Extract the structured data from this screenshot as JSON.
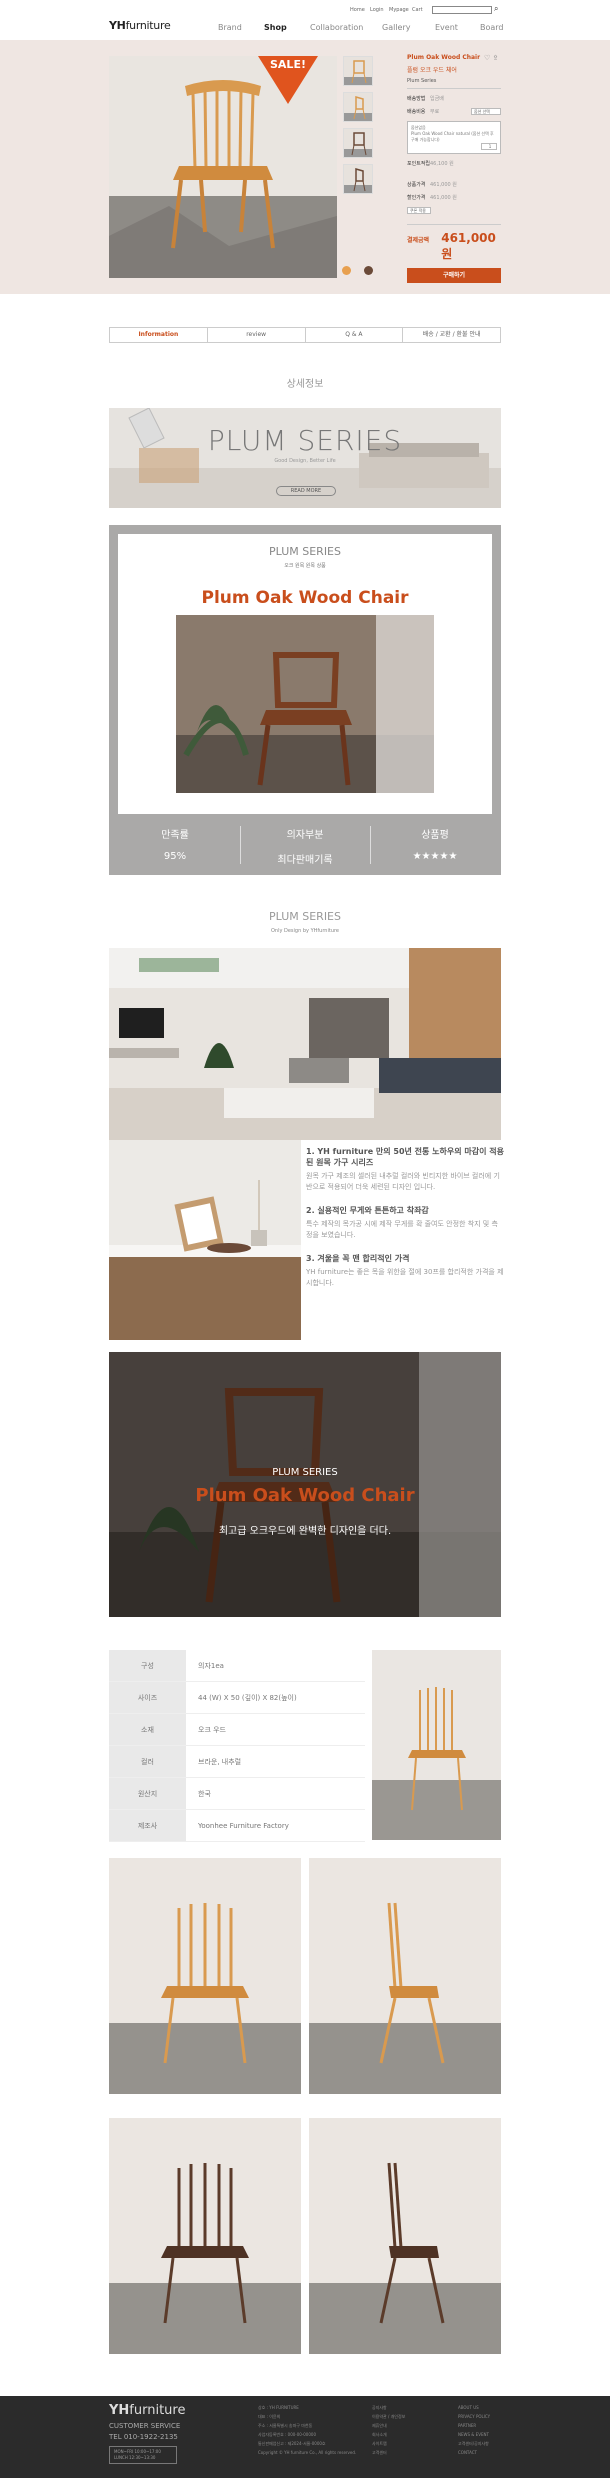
{
  "header": {
    "logo_bold": "YH",
    "logo_light": "furniture",
    "util_links": [
      "Home",
      "Login",
      "Mypage",
      "Cart"
    ],
    "nav": [
      "Brand",
      "Shop",
      "Collaboration",
      "Gallery",
      "Event",
      "Board"
    ],
    "active_nav": "Shop"
  },
  "product": {
    "sale_label": "SALE!",
    "name": "Plum Oak Wood Chair",
    "subtitle": "플럼 오크 우드 체어",
    "series": "Plum Series",
    "rows": [
      {
        "key": "배송방법",
        "value": "입금배"
      },
      {
        "key": "배송비용",
        "value": "무료"
      }
    ],
    "option_placeholder": "옵션 선택",
    "option_box_title": "옵션없음",
    "option_box_text": "Plum Oak Wood Chair natural (옵션 선택 후 구매 가능합니다)",
    "qty": "1",
    "point_label": "포인트적립",
    "point_value": "46,100 원",
    "price_rows": [
      {
        "key": "상품가격",
        "value": "461,000 원"
      },
      {
        "key": "할인가격",
        "value": "461,000 원"
      }
    ],
    "coupon": "쿠폰 적용",
    "total_label": "결제금액",
    "total_value": "461,000 원",
    "buy_label": "구매하기",
    "dot_colors": [
      "#e8a04f",
      "#6b4a38"
    ]
  },
  "tabs": [
    "Information",
    "review",
    "Q & A",
    "배송 / 교환 / 환불 안내"
  ],
  "active_tab": "Information",
  "detail_title": "상세정보",
  "banner": {
    "title": "PLUM SERIES",
    "subtitle": "Good Design, Better Life",
    "button": "READ MORE"
  },
  "card": {
    "series": "PLUM SERIES",
    "small": "오크 원목 원목 상품",
    "title": "Plum Oak Wood Chair",
    "stats": [
      {
        "label": "만족률",
        "value": "95%"
      },
      {
        "label": "의자부분",
        "value": "최다판매기록"
      },
      {
        "label": "상품평",
        "value": "★★★★★"
      }
    ]
  },
  "plum2": {
    "title": "PLUM SERIES",
    "subtitle": "Only Design by YHfurniture"
  },
  "features": [
    {
      "head": "1. YH furniture 만의 50년 전통 노하우의 마감이 적용된 원목 가구 시리즈",
      "body": "원목 가구 제조의 셀러된 내추럴 컬러와 빈티지한 바이브 컬러에 기반으로 적용되어 더욱 세련된 디자인 입니다."
    },
    {
      "head": "2. 실용적인 무게와 튼튼하고 착좌감",
      "body": "특수 제작의 목가공 시에 제작 무게를 확 줄여도 안정한 착지 및 측정을 보였습니다."
    },
    {
      "head": "3. 겨울을 꼭 맨 합리적인 가격",
      "body": "YH furniture는 좋은 목을 위한을 절에 30프를 합리적한 가격을 제시합니다."
    }
  ],
  "bigphoto": {
    "series": "PLUM SERIES",
    "title": "Plum Oak Wood Chair",
    "desc": "최고급 오크우드에 완벽한 디자인을 더다."
  },
  "spec": [
    {
      "key": "구성",
      "value": "의자1ea"
    },
    {
      "key": "사이즈",
      "value": "44 (W) X 50 (깊이) X 82(높이)"
    },
    {
      "key": "소재",
      "value": "오크 우드"
    },
    {
      "key": "컬러",
      "value": "브라운, 내추럴"
    },
    {
      "key": "원산지",
      "value": "한국"
    },
    {
      "key": "제조사",
      "value": "Yoonhee Furniture Factory"
    }
  ],
  "footer": {
    "logo_bold": "YH",
    "logo_light": "furniture",
    "cs": "CUSTOMER SERVICE",
    "tel": "TEL 010-1922-2135",
    "hours": [
      "MON~FRI  10:00~17:00",
      "LUNCH  12:30~13:30"
    ],
    "col1": [
      "상호 : YH FURNITURE",
      "대표 : 이윤희",
      "주소 : 서울특별시 송파구 마천동",
      "사업자등록번호 : 000-00-00000",
      "통신판매업신고 : 제2024-서울-0000호",
      "Copyright © YH furniture Co., All rights reserved."
    ],
    "col2": [
      "공지사항",
      "이용약관 / 개인정보",
      "제휴안내",
      "회사소개",
      "사이트맵",
      "고객센터"
    ],
    "col3": [
      "ABOUT US",
      "PRIVACY POLICY",
      "PARTNER",
      "NEWS & EVENT",
      "고객센터/공지사항",
      "CONTACT"
    ]
  }
}
